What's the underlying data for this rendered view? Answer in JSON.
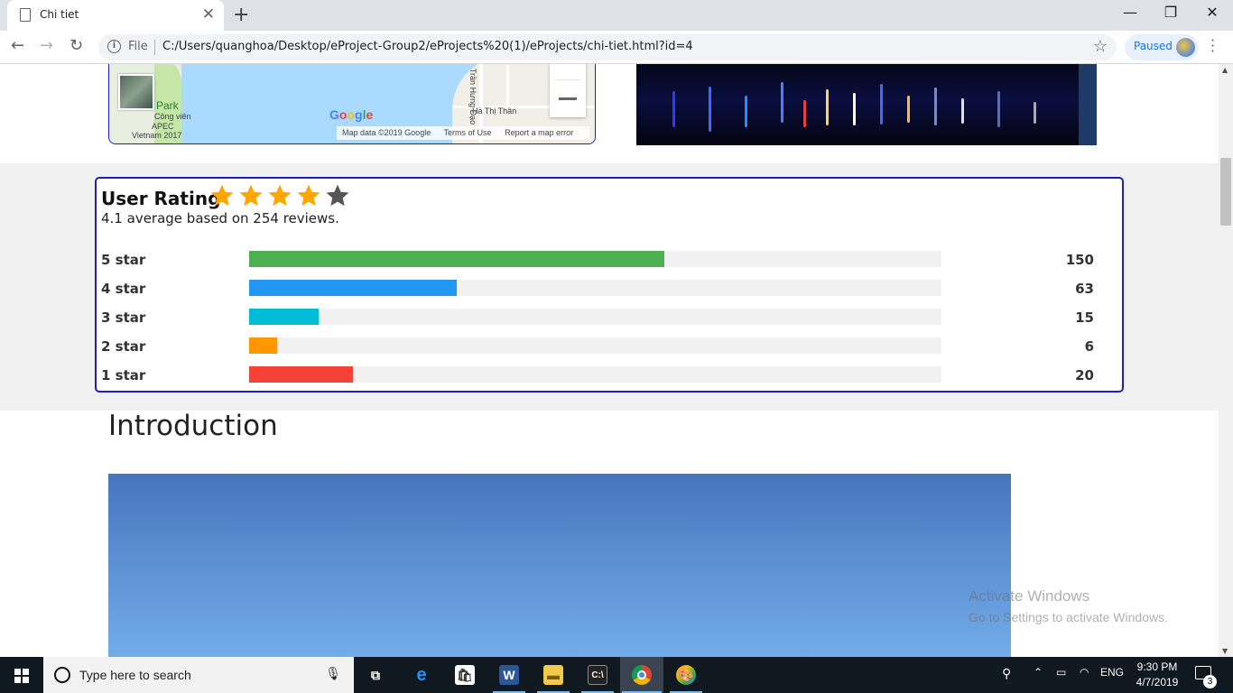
{
  "browser": {
    "tab_title": "Chi tiet",
    "new_tab_symbol": "+",
    "close_tab_symbol": "✕",
    "window_controls": {
      "minimize": "—",
      "maximize": "❐",
      "close": "✕"
    },
    "file_label": "File",
    "url": "C:/Users/quanghoa/Desktop/eProject-Group2/eProjects%20(1)/eProjects/chi-tiet.html?id=4",
    "profile_status": "Paused"
  },
  "map": {
    "labels": {
      "park": "Park",
      "cong_vien": "Công viên",
      "apec": "APEC",
      "vietnam": "Vietnam 2017",
      "street1": "Trần Hưng Đạo",
      "street2": "Hà Thị Thân"
    },
    "google_logo": "Google",
    "footer": {
      "data": "Map data ©2019 Google",
      "terms": "Terms of Use",
      "report": "Report a map error"
    },
    "zoom_in": "+",
    "zoom_out": "−"
  },
  "rating": {
    "title": "User Rating",
    "average": 4.1,
    "total_reviews": 254,
    "summary": "4.1 average based on 254 reviews.",
    "filled_stars": 4,
    "total_stars": 5,
    "star_color": "#ffa500",
    "empty_star_color": "#555555",
    "bars": [
      {
        "label": "5 star",
        "count": "150",
        "color": "#4caf50",
        "fraction": 0.6
      },
      {
        "label": "4 star",
        "count": "63",
        "color": "#2196f3",
        "fraction": 0.3
      },
      {
        "label": "3 star",
        "count": "15",
        "color": "#00bcd4",
        "fraction": 0.1
      },
      {
        "label": "2 star",
        "count": "6",
        "color": "#ff9800",
        "fraction": 0.04
      },
      {
        "label": "1 star",
        "count": "20",
        "color": "#f44336",
        "fraction": 0.15
      }
    ]
  },
  "introduction": {
    "heading": "Introduction"
  },
  "watermark": {
    "line1": "Activate Windows",
    "line2": "Go to Settings to activate Windows."
  },
  "taskbar": {
    "search_placeholder": "Type here to search",
    "language": "ENG",
    "time": "9:30 PM",
    "date": "4/7/2019",
    "notification_count": "3",
    "apps": [
      "task-view",
      "edge",
      "store",
      "word",
      "file-explorer",
      "cmd",
      "chrome",
      "paint"
    ]
  },
  "icons": {
    "page": "page-icon",
    "back": "back-arrow-icon",
    "forward": "forward-arrow-icon",
    "reload": "reload-icon",
    "info": "info-icon",
    "bookmark": "star-outline-icon",
    "menu": "kebab-menu-icon"
  }
}
